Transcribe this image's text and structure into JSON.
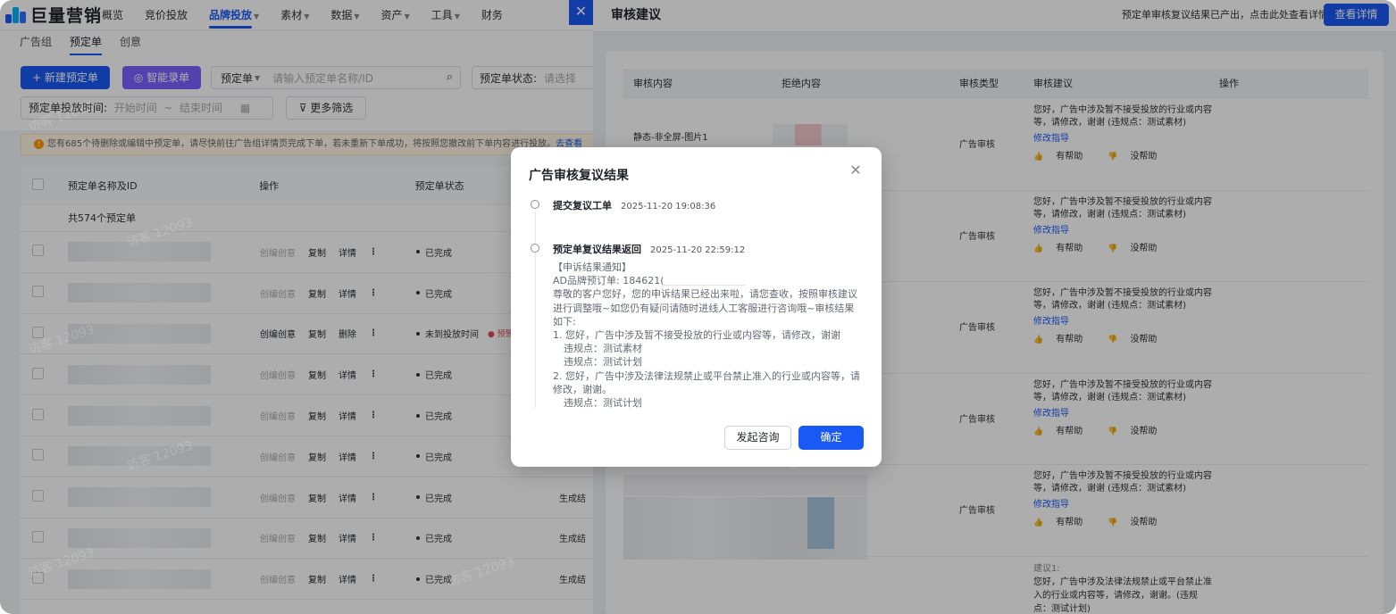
{
  "brand": {
    "name": "巨量营销"
  },
  "topnav": {
    "items": [
      "概览",
      "竞价投放",
      "品牌投放",
      "素材",
      "数据",
      "资产",
      "工具",
      "财务"
    ],
    "close_icon": "✕"
  },
  "subtabs": [
    "广告组",
    "预定单",
    "创意"
  ],
  "toolbar": {
    "new_button": "+ 新建预定单",
    "smart_button": "智能录单",
    "filter_type": "预定单",
    "search_placeholder": "请输入预定单名称/ID",
    "status_label": "预定单状态:",
    "status_placeholder": "请选择",
    "time_label": "预定单投放时间:",
    "start_placeholder": "开始时间",
    "end_placeholder": "结束时间",
    "more_filter": "更多筛选"
  },
  "notice": {
    "text": "您有685个待删除或编辑中预定单，请尽快前往广告组详情页完成下单，若未重新下单成功，将按照您撤改前下单内容进行投放。",
    "link": "去查看"
  },
  "table": {
    "headers": [
      "预定单名称及ID",
      "操作",
      "预定单状态"
    ],
    "count": "共574个预定单",
    "rows": [
      {
        "op1": "创编创意",
        "op2": "复制",
        "op3": "详情",
        "status": "已完成",
        "extra": ""
      },
      {
        "op1": "创编创意",
        "op2": "复制",
        "op3": "详情",
        "status": "已完成",
        "extra": ""
      },
      {
        "op1": "创编创意",
        "op2": "复制",
        "op3": "删除",
        "status": "未到投放时间",
        "extra": "",
        "tag": "● 预警"
      },
      {
        "op1": "创编创意",
        "op2": "复制",
        "op3": "详情",
        "status": "已完成",
        "extra": ""
      },
      {
        "op1": "创编创意",
        "op2": "复制",
        "op3": "详情",
        "status": "已完成",
        "extra": ""
      },
      {
        "op1": "创编创意",
        "op2": "复制",
        "op3": "详情",
        "status": "已完成",
        "extra": ""
      },
      {
        "op1": "创编创意",
        "op2": "复制",
        "op3": "详情",
        "status": "已完成",
        "extra": "生成结"
      },
      {
        "op1": "创编创意",
        "op2": "复制",
        "op3": "详情",
        "status": "已完成",
        "extra": "生成结"
      },
      {
        "op1": "创编创意",
        "op2": "复制",
        "op3": "详情",
        "status": "已完成",
        "extra": "生成结"
      }
    ]
  },
  "drawer": {
    "title": "审核建议",
    "hint": "预定单审核复议结果已产出，点击此处查看详情。",
    "view_button": "查看详情",
    "headers": [
      "审核内容",
      "拒绝内容",
      "审核类型",
      "审核建议",
      "操作"
    ],
    "rows": [
      {
        "content": "静态-非全屏-图片1",
        "type": "广告审核",
        "suggest": "您好，广告中涉及暂不接受投放的行业或内容等，请修改，谢谢 (违规点：测试素材)",
        "guide": "修改指导",
        "helpful": "有帮助",
        "unhelpful": "没帮助"
      },
      {
        "content": "",
        "type": "广告审核",
        "suggest": "您好，广告中涉及暂不接受投放的行业或内容等，请修改，谢谢 (违规点：测试素材)",
        "guide": "修改指导",
        "helpful": "有帮助",
        "unhelpful": "没帮助"
      },
      {
        "content": "",
        "type": "广告审核",
        "suggest": "您好，广告中涉及暂不接受投放的行业或内容等，请修改，谢谢 (违规点：测试素材)",
        "guide": "修改指导",
        "helpful": "有帮助",
        "unhelpful": "没帮助"
      },
      {
        "content": "",
        "type": "广告审核",
        "suggest": "您好，广告中涉及暂不接受投放的行业或内容等，请修改，谢谢 (违规点：测试素材)",
        "guide": "修改指导",
        "helpful": "有帮助",
        "unhelpful": "没帮助"
      },
      {
        "content": "",
        "type": "广告审核",
        "suggest": "您好，广告中涉及暂不接受投放的行业或内容等，请修改，谢谢 (违规点：测试素材)",
        "guide": "修改指导",
        "helpful": "有帮助",
        "unhelpful": "没帮助"
      }
    ],
    "last": {
      "label": "建议1:",
      "text": "您好，广告中涉及法律法规禁止或平台禁止准入的行业或内容等，请修改，谢谢。(违规点：测试计划)"
    }
  },
  "modal": {
    "title": "广告审核复议结果",
    "close_icon": "✕",
    "step1": {
      "title": "提交复议工单",
      "time": "2025-11-20 19:08:36"
    },
    "step2": {
      "title": "预定单复议结果返回",
      "time": "2025-11-20 22:59:12"
    },
    "body": {
      "heading": "【申诉结果通知】",
      "order_label": "AD品牌预订单: 184621(",
      "intro": "尊敬的客户您好，您的申诉结果已经出来啦，请您查收，按照审核建议进行调整哦~如您仍有疑问请随时进线人工客服进行咨询哦~审核结果如下:",
      "item1": "1. 您好，广告中涉及暂不接受投放的行业或内容等，请修改，谢谢",
      "item1_v1": "违规点：测试素材",
      "item1_v2": "违规点：测试计划",
      "item2": "2. 您好，广告中涉及法律法规禁止或平台禁止准入的行业或内容等，请修改，谢谢。",
      "item2_v1": "违规点：测试计划"
    },
    "consult_button": "发起咨询",
    "ok_button": "确定"
  },
  "watermark": "访客 12093",
  "colors": {
    "primary": "#1a59f5",
    "smart": "#7b61ff",
    "warn": "#ff9a00"
  }
}
